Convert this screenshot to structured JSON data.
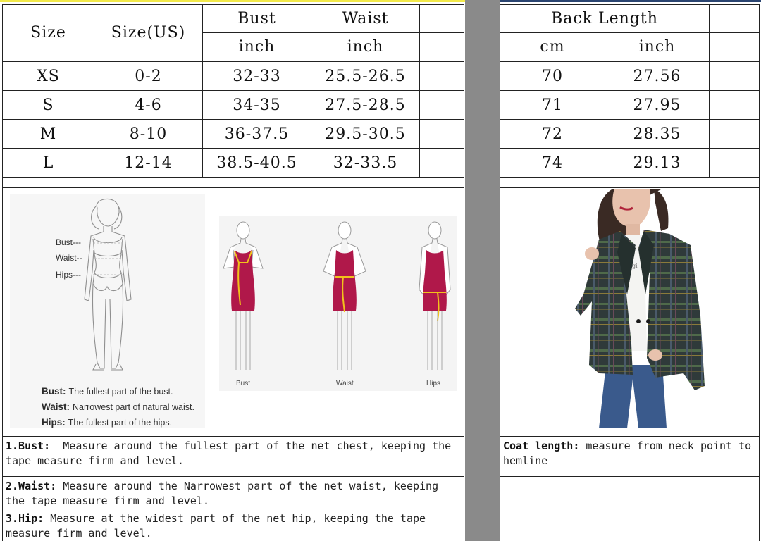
{
  "size_table": {
    "headers": {
      "size": "Size",
      "size_us": "Size(US)",
      "bust": "Bust",
      "waist": "Waist",
      "bust_unit": "inch",
      "waist_unit": "inch"
    },
    "rows": [
      {
        "size": "XS",
        "us": "0-2",
        "bust": "32-33",
        "waist": "25.5-26.5"
      },
      {
        "size": "S",
        "us": "4-6",
        "bust": "34-35",
        "waist": "27.5-28.5"
      },
      {
        "size": "M",
        "us": "8-10",
        "bust": "36-37.5",
        "waist": "29.5-30.5"
      },
      {
        "size": "L",
        "us": "12-14",
        "bust": "38.5-40.5",
        "waist": "32-33.5"
      }
    ]
  },
  "back_table": {
    "header": "Back Length",
    "unit_cm": "cm",
    "unit_inch": "inch",
    "rows": [
      {
        "cm": "70",
        "inch": "27.56"
      },
      {
        "cm": "71",
        "inch": "27.95"
      },
      {
        "cm": "72",
        "inch": "28.35"
      },
      {
        "cm": "74",
        "inch": "29.13"
      }
    ]
  },
  "outline_figure": {
    "labels": {
      "bust": "Bust---",
      "waist": "Waist--",
      "hips": "Hips---"
    },
    "definitions": [
      {
        "term": "Bust:",
        "text": "The fullest part of the bust."
      },
      {
        "term": "Waist:",
        "text": "Narrowest part of natural waist."
      },
      {
        "term": "Hips:",
        "text": "The fullest part of the hips."
      }
    ]
  },
  "dress_figure": {
    "captions": [
      "Bust",
      "Waist",
      "Hips"
    ],
    "dress_color": "#b0184a",
    "tape_color": "#f2c21b"
  },
  "instructions": [
    {
      "term": "1.Bust:",
      "text": "Measure around the fullest part of the net chest, keeping the tape  measure firm and level."
    },
    {
      "term": "2.Waist:",
      "text": "Measure around the Narrowest part of the net waist, keeping the tape  measure firm and level."
    },
    {
      "term": "3.Hip:",
      "text": "Measure at the widest part of the net hip, keeping the tape measure firm and level."
    }
  ],
  "coat_note": {
    "term": "Coat length:",
    "text": "measure from neck point to hemline"
  },
  "colors": {
    "divider": "#8a8a8a",
    "left_top_accent": "#f2e94a",
    "right_top_accent": "#2a4470",
    "coat_plaid": "#2f3a3a",
    "jeans": "#3a5a8c"
  },
  "photo": {
    "shirt_print": "Digi"
  }
}
